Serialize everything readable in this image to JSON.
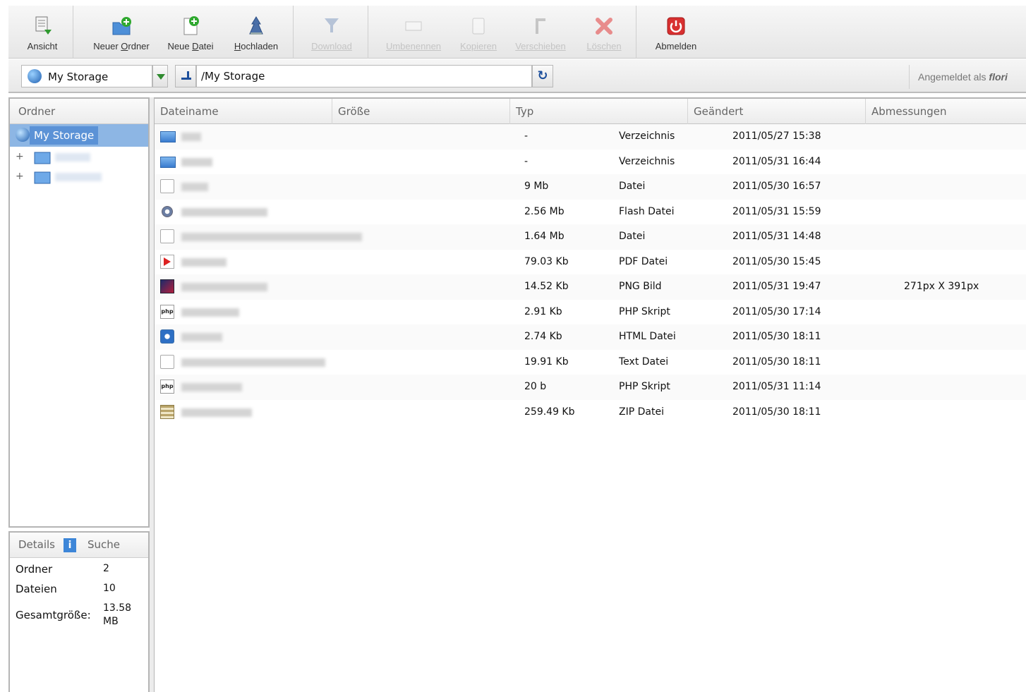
{
  "toolbar": {
    "buttons": [
      {
        "id": "ansicht",
        "label": "Ansicht",
        "enabled": true
      },
      {
        "id": "neuer-ordner",
        "label_pre": "Neuer ",
        "label_u": "O",
        "label_post": "rdner",
        "enabled": true
      },
      {
        "id": "neue-datei",
        "label_pre": "Neue ",
        "label_u": "D",
        "label_post": "atei",
        "enabled": true
      },
      {
        "id": "hochladen",
        "label_pre": "",
        "label_u": "H",
        "label_post": "ochladen",
        "enabled": true
      },
      {
        "id": "download",
        "label": "Download",
        "enabled": false
      },
      {
        "id": "umbenennen",
        "label": "Umbenennen",
        "enabled": false
      },
      {
        "id": "kopieren",
        "label": "Kopieren",
        "enabled": false
      },
      {
        "id": "verschieben",
        "label": "Verschieben",
        "enabled": false
      },
      {
        "id": "loeschen",
        "label": "Löschen",
        "enabled": false
      },
      {
        "id": "abmelden",
        "label": "Abmelden",
        "enabled": true
      }
    ]
  },
  "address": {
    "storage": "My Storage",
    "path": "/My Storage",
    "login_prefix": "Angemeldet als",
    "login_user": "flori"
  },
  "tree": {
    "header": "Ordner",
    "root": "My Storage",
    "nodes": 2
  },
  "details": {
    "tab_details": "Details",
    "tab_search": "Suche",
    "rows": [
      {
        "label": "Ordner",
        "value": "2"
      },
      {
        "label": "Dateien",
        "value": "10"
      },
      {
        "label": "Gesamtgröße:",
        "value": "13.58",
        "value2": "MB"
      }
    ]
  },
  "grid": {
    "columns": [
      "Dateiname",
      "Größe",
      "Typ",
      "Geändert",
      "Abmessungen"
    ],
    "rows": [
      {
        "icon": "folder",
        "size": "-",
        "type": "Verzeichnis",
        "modified": "2011/05/27 15:38",
        "dims": "",
        "name_w": 28
      },
      {
        "icon": "folder",
        "size": "-",
        "type": "Verzeichnis",
        "modified": "2011/05/31 16:44",
        "dims": "",
        "name_w": 44
      },
      {
        "icon": "file",
        "size": "9 Mb",
        "type": "Datei",
        "modified": "2011/05/30 16:57",
        "dims": "",
        "name_w": 38
      },
      {
        "icon": "flash",
        "size": "2.56 Mb",
        "type": "Flash Datei",
        "modified": "2011/05/31 15:59",
        "dims": "",
        "name_w": 122
      },
      {
        "icon": "file",
        "size": "1.64 Mb",
        "type": "Datei",
        "modified": "2011/05/31 14:48",
        "dims": "",
        "name_w": 256
      },
      {
        "icon": "pdf",
        "size": "79.03 Kb",
        "type": "PDF Datei",
        "modified": "2011/05/30 15:45",
        "dims": "",
        "name_w": 64
      },
      {
        "icon": "png",
        "size": "14.52 Kb",
        "type": "PNG Bild",
        "modified": "2011/05/31 19:47",
        "dims": "271px X 391px",
        "name_w": 122
      },
      {
        "icon": "php",
        "size": "2.91 Kb",
        "type": "PHP Skript",
        "modified": "2011/05/30 17:14",
        "dims": "",
        "name_w": 82
      },
      {
        "icon": "html",
        "size": "2.74 Kb",
        "type": "HTML Datei",
        "modified": "2011/05/30 18:11",
        "dims": "",
        "name_w": 58
      },
      {
        "icon": "text",
        "size": "19.91 Kb",
        "type": "Text Datei",
        "modified": "2011/05/30 18:11",
        "dims": "",
        "name_w": 204
      },
      {
        "icon": "php",
        "size": "20 b",
        "type": "PHP Skript",
        "modified": "2011/05/31 11:14",
        "dims": "",
        "name_w": 86
      },
      {
        "icon": "zip",
        "size": "259.49 Kb",
        "type": "ZIP Datei",
        "modified": "2011/05/30 18:11",
        "dims": "",
        "name_w": 100
      }
    ]
  },
  "colors": {
    "accent": "#5b92d6",
    "selection": "#8db6e4",
    "disabled_text": "#c4c4c4"
  }
}
